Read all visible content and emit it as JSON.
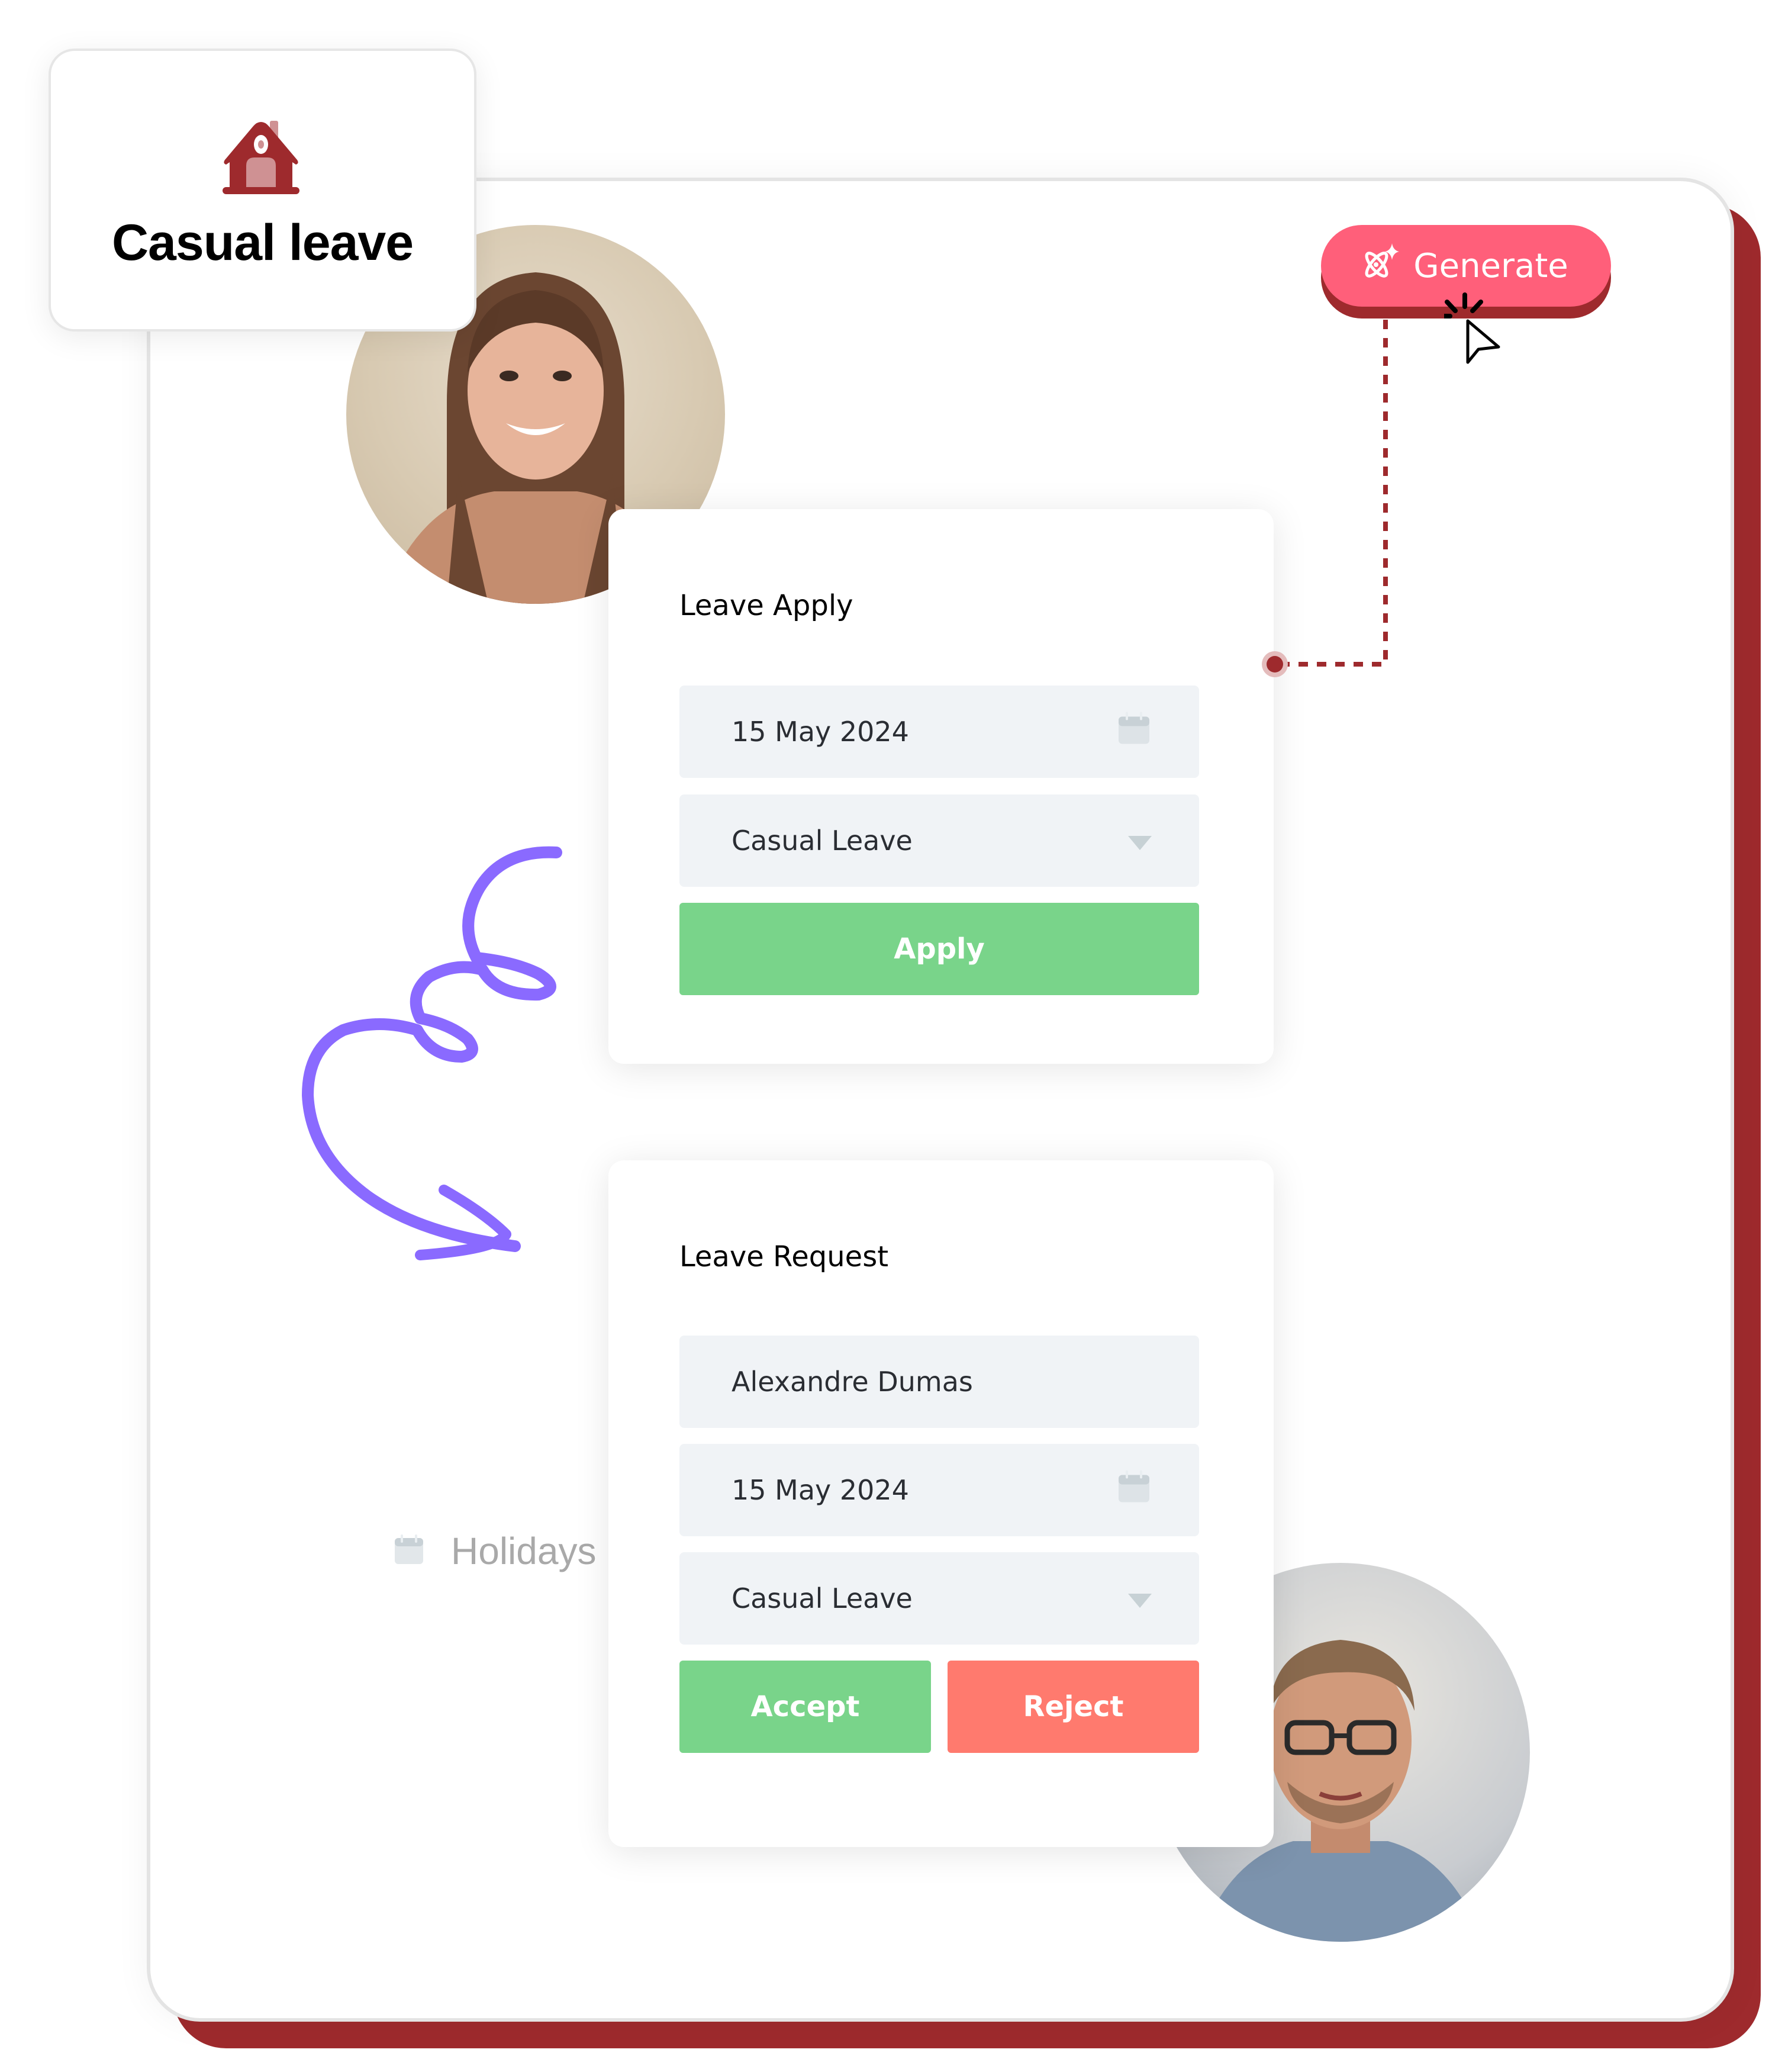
{
  "badge": {
    "icon": "house-icon",
    "title": "Casual leave"
  },
  "generate": {
    "label": "Generate",
    "icon": "ai-sparkle-icon"
  },
  "leave_apply": {
    "title": "Leave Apply",
    "date_value": "15 May 2024",
    "date_icon": "calendar-icon",
    "leave_type_value": "Casual Leave",
    "leave_type_icon": "chevron-down-icon",
    "apply_label": "Apply"
  },
  "leave_request": {
    "title": "Leave Request",
    "name_value": "Alexandre Dumas",
    "date_value": "15 May 2024",
    "date_icon": "calendar-icon",
    "leave_type_value": "Casual Leave",
    "leave_type_icon": "chevron-down-icon",
    "accept_label": "Accept",
    "reject_label": "Reject"
  },
  "holidays": {
    "label": "Holidays",
    "icon": "calendar-icon"
  },
  "avatars": [
    {
      "name": "applicant-avatar"
    },
    {
      "name": "approver-avatar"
    }
  ],
  "colors": {
    "brand_red": "#9e2a2d",
    "generate_pink": "#ff5f7a",
    "accept_green": "#79d48a",
    "reject_red": "#ff7a6e",
    "arrow_purple": "#8a6aff",
    "field_bg": "#f0f3f6"
  }
}
